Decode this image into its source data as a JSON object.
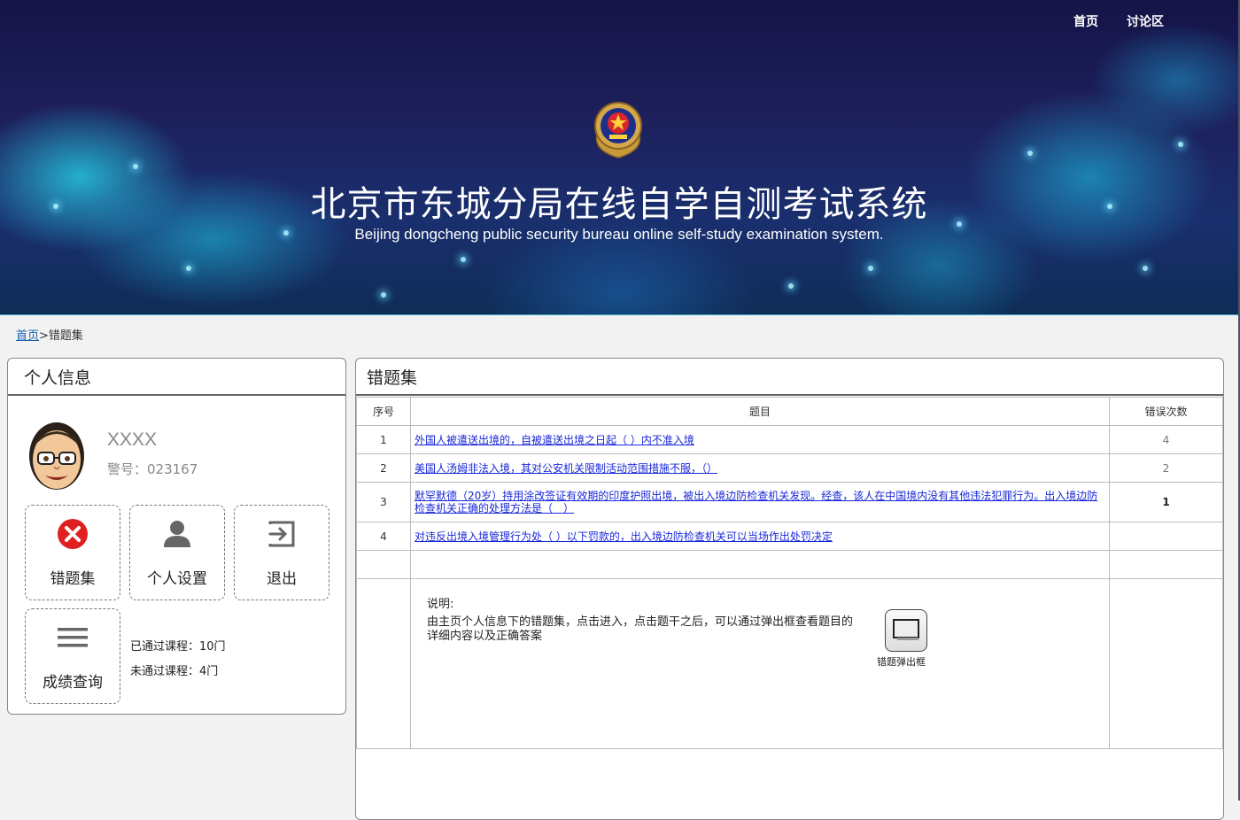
{
  "nav": {
    "home": "首页",
    "forum": "讨论区"
  },
  "banner": {
    "title_cn": "北京市东城分局在线自学自测考试系统",
    "title_en": "Beijing dongcheng public security bureau online self-study examination system."
  },
  "breadcrumb": {
    "home": "首页",
    "separator": ">",
    "current": "错题集"
  },
  "profile": {
    "title": "个人信息",
    "name": "XXXX",
    "badge_id": "警号：023167",
    "tiles": {
      "mistakes": "错题集",
      "settings": "个人设置",
      "logout": "退出",
      "grades": "成绩查询"
    },
    "passed": "已通过课程：10门",
    "failed": "未通过课程：4门"
  },
  "mistakes": {
    "title": "错题集",
    "headers": {
      "no": "序号",
      "question": "题目",
      "count": "错误次数"
    },
    "rows": [
      {
        "no": "1",
        "question": "外国人被遣送出境的，自被遣送出境之日起（ ）内不准入境",
        "count": "4"
      },
      {
        "no": "2",
        "question": "美国人汤姆非法入境，其对公安机关限制活动范围措施不服，（）",
        "count": "2"
      },
      {
        "no": "3",
        "question": "默罕默德（20岁）持用涂改签证有效期的印度护照出境，被出入境边防检查机关发现。经查，该人在中国境内没有其他违法犯罪行为。出入境边防检查机关正确的处理方法是（　）",
        "count": "1"
      },
      {
        "no": "4",
        "question": "对违反出境入境管理行为处（ ）以下罚款的，出入境边防检查机关可以当场作出处罚决定",
        "count": ""
      }
    ],
    "note_label": "说明:",
    "note_text": "由主页个人信息下的错题集，点击进入，点击题干之后，可以通过弹出框查看题目的详细内容以及正确答案",
    "popup_label": "错题弹出框"
  },
  "icons": {
    "mistakes": "error-circle-icon",
    "settings": "person-icon",
    "logout": "exit-icon",
    "grades": "menu-lines-icon",
    "popup": "window-icon"
  },
  "colors": {
    "error_red": "#e02020",
    "link_blue": "#1a29d8",
    "nav_text": "#ffffff"
  }
}
